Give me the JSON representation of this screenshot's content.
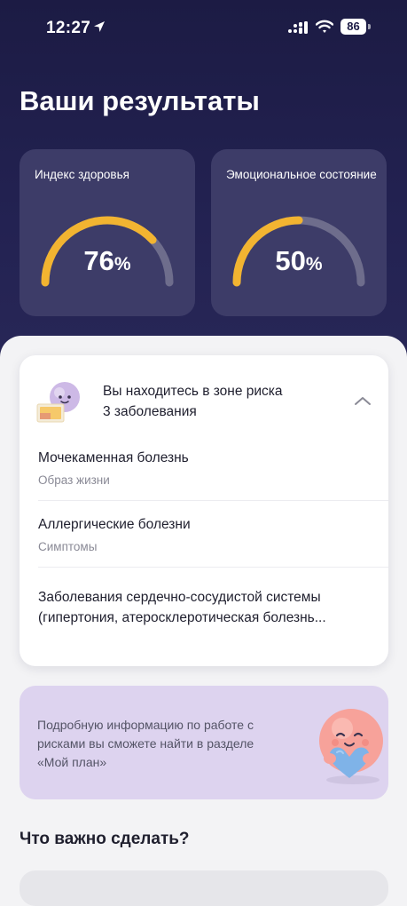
{
  "status_bar": {
    "time": "12:27",
    "battery": "86"
  },
  "header": {
    "title": "Ваши результаты"
  },
  "metrics": [
    {
      "label": "Индекс здоровья",
      "value": "76",
      "unit": "%",
      "progress": 0.76
    },
    {
      "label": "Эмоциональное состояние",
      "value": "50",
      "unit": "%",
      "progress": 0.5
    }
  ],
  "risk": {
    "title_line1": "Вы находитесь в зоне риска",
    "title_line2": "3 заболевания",
    "items": [
      {
        "name": "Мочекаменная болезнь",
        "category": "Образ жизни"
      },
      {
        "name": "Аллергические болезни",
        "category": "Симптомы"
      },
      {
        "name_line1": "Заболевания сердечно-сосудистой системы",
        "name_line2": "(гипертония, атеросклеротическая болезнь..."
      }
    ]
  },
  "info": {
    "text": "Подробную информацию по работе с рисками вы сможете найти в разделе «Мой план»"
  },
  "todo": {
    "title": "Что важно сделать?"
  },
  "colors": {
    "hero_bg": "#1f1e4a",
    "card_bg": "#3d3c68",
    "gauge_fill": "#f2b431",
    "gauge_track": "#6e6d8c",
    "info_bg": "#ddd3ef"
  }
}
